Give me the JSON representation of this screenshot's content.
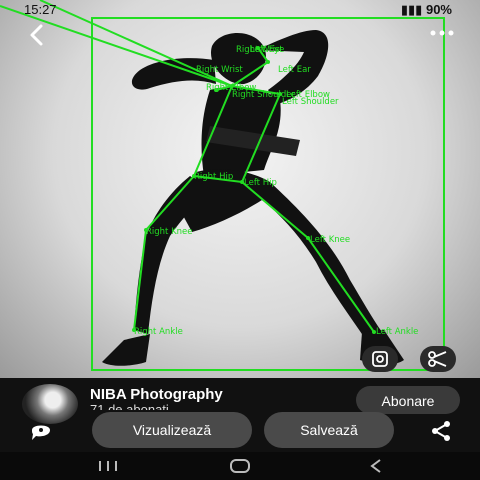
{
  "status": {
    "time": "15:27",
    "battery": "90%"
  },
  "pose_labels": {
    "right_wrist": "Right Wrist",
    "left_eye": "Left Eye",
    "right_wrist2": "Right Wrist",
    "left_ear": "Left Ear",
    "right_elbow": "Right Elbow",
    "right_shoulder": "Right Shoulder",
    "left_elbow": "Left Elbow",
    "left_shoulder": "Left Shoulder",
    "right_hip": "Right Hip",
    "left_hip": "Left Hip",
    "right_knee": "Right Knee",
    "left_knee": "Left Knee",
    "right_ankle": "Right Ankle",
    "left_ankle": "Left Ankle"
  },
  "channel": {
    "name": "NIBA Photography",
    "subscribers": "71 de abonați"
  },
  "buttons": {
    "subscribe": "Abonare",
    "view": "Vizualizează",
    "save": "Salvează"
  },
  "colors": {
    "overlay": "#22dd22",
    "pill": "#4a4a4a",
    "background": "#111111"
  },
  "icons": [
    "back-icon",
    "more-icon",
    "lens-icon",
    "cut-icon",
    "comment-icon",
    "share-icon",
    "recents-icon",
    "home-icon",
    "back-nav-icon"
  ]
}
